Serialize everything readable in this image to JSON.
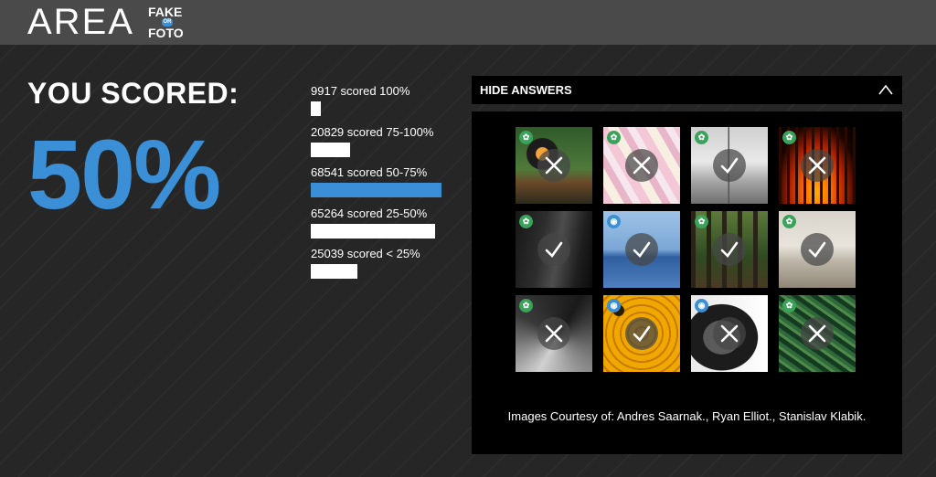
{
  "header": {
    "logo_text": "AREA",
    "badge_word_top": "FAKE",
    "badge_word_mid": "OR",
    "badge_word_bottom": "FOTO"
  },
  "result": {
    "heading": "YOU SCORED:",
    "score": "50%"
  },
  "distribution": [
    {
      "label": "9917 scored 100%",
      "share": 0.08,
      "current": false
    },
    {
      "label": "20829 scored 75-100%",
      "share": 0.3,
      "current": false
    },
    {
      "label": "68541 scored 50-75%",
      "share": 1.0,
      "current": true
    },
    {
      "label": "65264 scored 25-50%",
      "share": 0.95,
      "current": false
    },
    {
      "label": "25039 scored < 25%",
      "share": 0.36,
      "current": false
    }
  ],
  "answers": {
    "toggle_label": "HIDE ANSWERS",
    "credits": "Images Courtesy of: Andres Saarnak., Ryan Elliot., Stanislav Klabik.",
    "tiles": [
      {
        "subject": "toucan-bird",
        "type": "real",
        "result": "wrong"
      },
      {
        "subject": "marshmallows",
        "type": "real",
        "result": "wrong"
      },
      {
        "subject": "interior-room",
        "type": "real",
        "result": "correct"
      },
      {
        "subject": "fire-grill",
        "type": "real",
        "result": "wrong"
      },
      {
        "subject": "dark-interior",
        "type": "real",
        "result": "correct"
      },
      {
        "subject": "heron-seascape",
        "type": "fake",
        "result": "correct"
      },
      {
        "subject": "forest",
        "type": "real",
        "result": "correct"
      },
      {
        "subject": "kitchen",
        "type": "real",
        "result": "correct"
      },
      {
        "subject": "abstract-bw",
        "type": "real",
        "result": "wrong"
      },
      {
        "subject": "honeycomb-bees",
        "type": "fake",
        "result": "correct"
      },
      {
        "subject": "soldier-portrait",
        "type": "fake",
        "result": "wrong"
      },
      {
        "subject": "fern-leaves",
        "type": "real",
        "result": "wrong"
      }
    ]
  },
  "colors": {
    "accent": "#3a8fd6",
    "real_badge": "#3aa35a",
    "fake_badge": "#3a8fd6"
  }
}
